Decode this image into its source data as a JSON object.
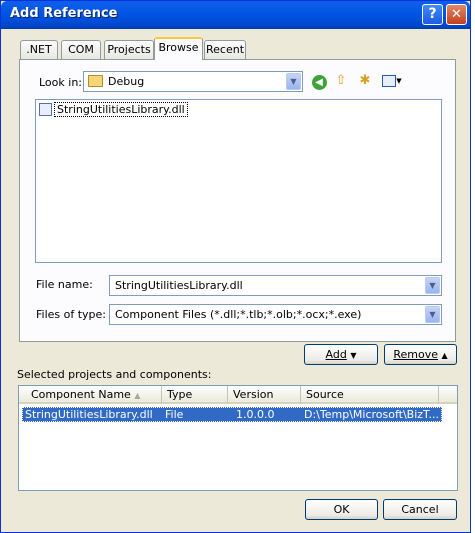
{
  "window": {
    "title": "Add Reference",
    "help_glyph": "?",
    "close_glyph": "✕"
  },
  "tabs": [
    {
      "label": ".NET",
      "active": false
    },
    {
      "label": "COM",
      "active": false
    },
    {
      "label": "Projects",
      "active": false
    },
    {
      "label": "Browse",
      "active": true
    },
    {
      "label": "Recent",
      "active": false
    }
  ],
  "browse": {
    "look_in_label": "Look in:",
    "look_in_value": "Debug",
    "look_in_icon": "folder-icon",
    "toolbar_icons": [
      "back-icon",
      "up-folder-icon",
      "new-folder-icon",
      "views-menu-icon"
    ],
    "files": [
      {
        "name": "StringUtilitiesLibrary.dll",
        "icon": "dll-file-icon"
      }
    ],
    "file_name_label": "File name:",
    "file_name_value": "StringUtilitiesLibrary.dll",
    "file_type_label": "Files of type:",
    "file_type_value": "Component Files (*.dll;*.tlb;*.olb;*.ocx;*.exe)"
  },
  "actions": {
    "add_label": "Add",
    "remove_label": "Remove"
  },
  "selected": {
    "section_label": "Selected projects and components:",
    "columns": [
      "Component Name",
      "Type",
      "Version",
      "Source"
    ],
    "rows": [
      {
        "name": "StringUtilitiesLibrary.dll",
        "type": "File",
        "version": "1.0.0.0",
        "source": "D:\\Temp\\Microsoft\\BizT..."
      }
    ]
  },
  "footer": {
    "ok_label": "OK",
    "cancel_label": "Cancel"
  },
  "colors": {
    "titlebar": "#0054e3",
    "selection": "#316ac5",
    "dialog_bg": "#ece9d8"
  }
}
